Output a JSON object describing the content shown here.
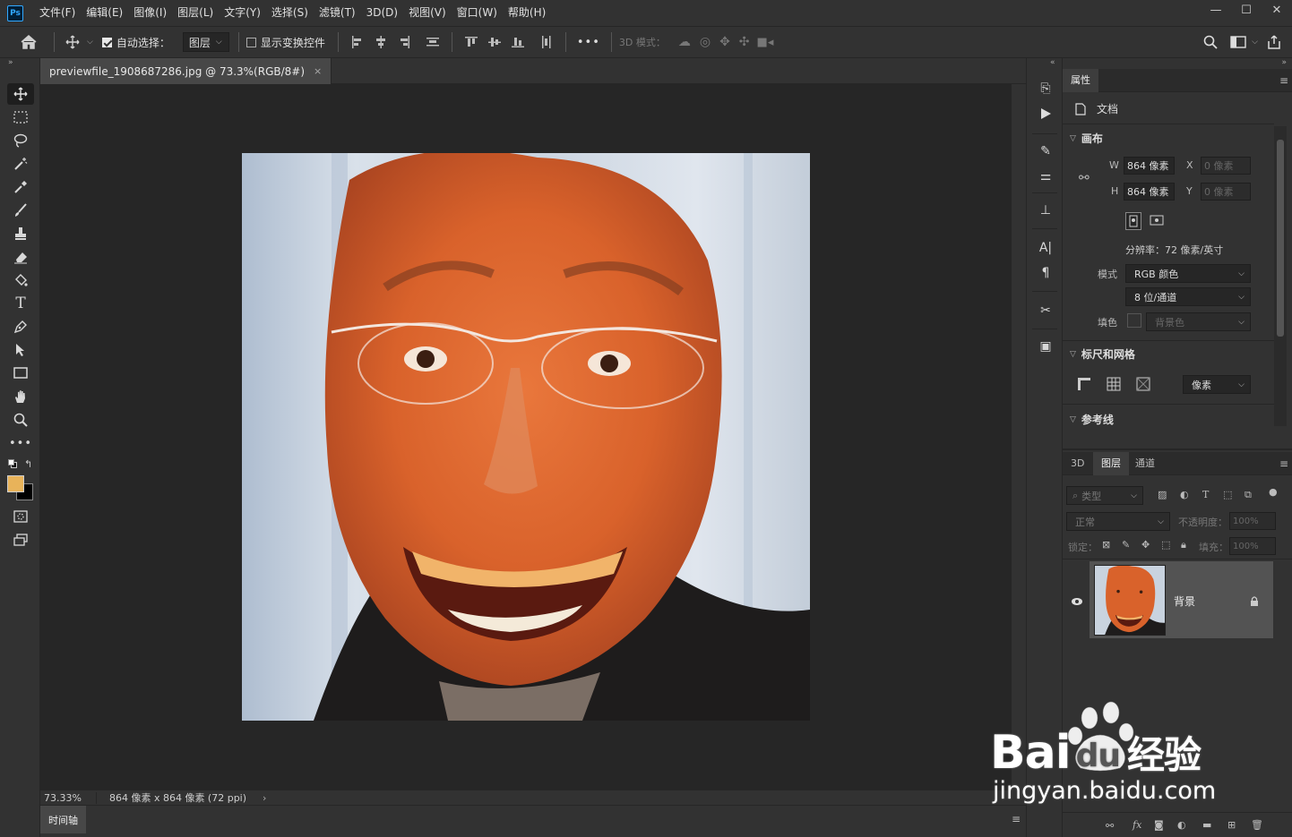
{
  "app": {
    "logo": "Ps"
  },
  "menu": [
    "文件(F)",
    "编辑(E)",
    "图像(I)",
    "图层(L)",
    "文字(Y)",
    "选择(S)",
    "滤镜(T)",
    "3D(D)",
    "视图(V)",
    "窗口(W)",
    "帮助(H)"
  ],
  "window_controls": {
    "minimize": "—",
    "restore": "☐",
    "close": "✕"
  },
  "options": {
    "auto_select_label": "自动选择：",
    "auto_select_target": "图层",
    "show_transform_label": "显示变换控件",
    "mode3d_label": "3D 模式：",
    "more": "•••"
  },
  "document": {
    "tab_title": "previewfile_1908687286.jpg @ 73.3%(RGB/8#)",
    "close": "×"
  },
  "status": {
    "zoom": "73.33%",
    "info": "864 像素 x 864 像素 (72 ppi)",
    "arrow": "›"
  },
  "timeline": {
    "tab": "时间轴"
  },
  "properties": {
    "tab": "属性",
    "doc_label": "文档",
    "canvas_section": "画布",
    "w_label": "W",
    "w_value": "864 像素",
    "h_label": "H",
    "h_value": "864 像素",
    "x_label": "X",
    "x_value": "0 像素",
    "y_label": "Y",
    "y_value": "0 像素",
    "resolution": "分辨率：72 像素/英寸",
    "mode_label": "模式",
    "mode_value": "RGB 颜色",
    "depth_value": "8 位/通道",
    "fill_label": "填色",
    "fill_value": "背景色",
    "rulers_section": "标尺和网格",
    "unit_value": "像素",
    "guides_section": "参考线"
  },
  "layers_panel": {
    "tabs": [
      "3D",
      "图层",
      "通道"
    ],
    "active_tab": "图层",
    "filter_placeholder": "类型",
    "blend_mode": "正常",
    "opacity_label": "不透明度：",
    "opacity_value": "100%",
    "lock_label": "锁定：",
    "fill_label": "填充：",
    "fill_value": "100%",
    "layer_name": "背景"
  },
  "watermark": {
    "brand_left": "Bai",
    "brand_mid": "du",
    "brand_right": "经验",
    "url": "jingyan.baidu.com"
  },
  "colors": {
    "foreground": "#e8b35a",
    "background": "#000000",
    "accent": "#31a8ff"
  }
}
